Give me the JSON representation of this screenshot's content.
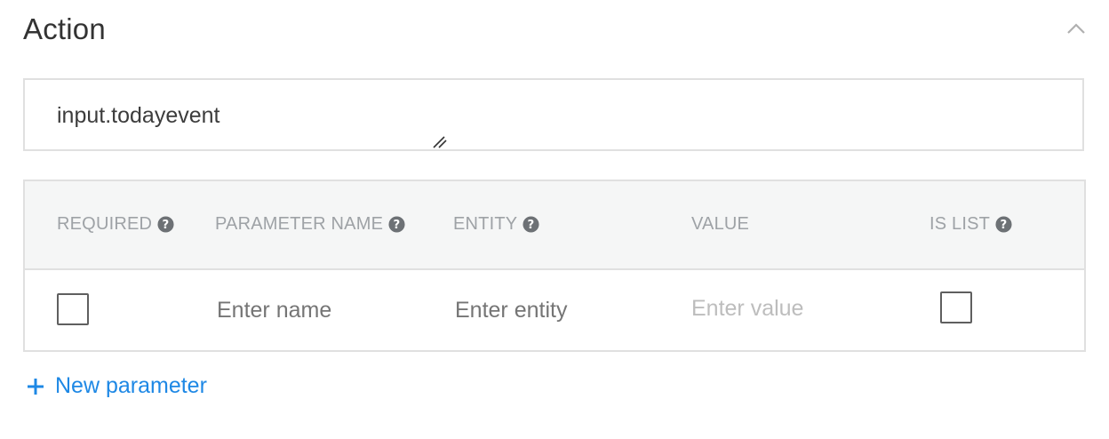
{
  "section": {
    "title": "Action"
  },
  "action": {
    "value": "input.todayevent"
  },
  "table": {
    "headers": {
      "required": "REQUIRED",
      "parameter_name": "PARAMETER NAME",
      "entity": "ENTITY",
      "value": "VALUE",
      "is_list": "IS LIST"
    },
    "row": {
      "name_placeholder": "Enter name",
      "entity_placeholder": "Enter entity",
      "value_placeholder": "Enter value"
    }
  },
  "new_parameter": {
    "label": "New parameter"
  },
  "icons": {
    "collapse": "chevron-up-icon",
    "help": "help-circle-icon",
    "resize": "resize-handle-icon",
    "add": "plus-icon"
  },
  "colors": {
    "accent": "#1e88e5",
    "header_bg": "#f5f6f6",
    "border": "#e0e0e0",
    "header_text": "#9ea2a6"
  }
}
